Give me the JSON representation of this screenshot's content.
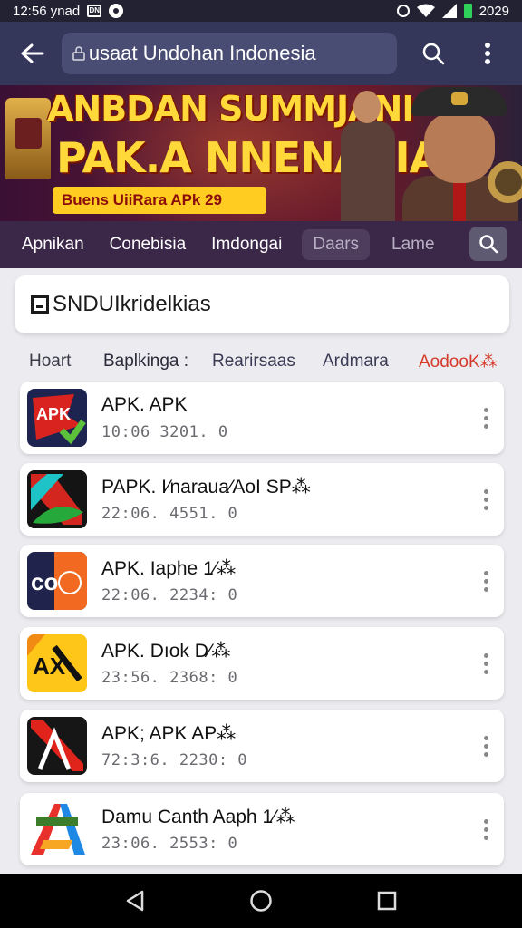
{
  "status_bar": {
    "time": "12:56 ynad",
    "box_icon_text": "DN",
    "battery_text": "2029"
  },
  "app_bar": {
    "search_value": "usaat Undohan Indonesia"
  },
  "banner": {
    "title_line1": "ANBDAN SUMMJANI",
    "title_line2": "PAK.A NNENASIAI",
    "tagline": "Buens UiiRara APk 29"
  },
  "categories": [
    {
      "label": "Apnikan"
    },
    {
      "label": "Conebisia"
    },
    {
      "label": "Imdongai"
    },
    {
      "label": "Daars"
    },
    {
      "label": "Lame"
    }
  ],
  "section": {
    "title": "SNDUIkridelkias"
  },
  "filters": [
    {
      "label": "Hoart"
    },
    {
      "label": "Baplkinga :"
    },
    {
      "label": "Rearirsaas"
    },
    {
      "label": "Ardmara"
    },
    {
      "label": "AodooK⁂"
    }
  ],
  "apps": [
    {
      "name": "APK. APK",
      "meta": "10:06  3201. 0",
      "icon": "apk-red-icon"
    },
    {
      "name": "PAPK. I⁄naraua⁄AoI SP⁂",
      "meta": "22:06. 4551. 0",
      "icon": "apk-green-icon"
    },
    {
      "name": "APK. Iaphe 1⁄⁂",
      "meta": "22:06. 2234: 0",
      "icon": "apk-orange-icon"
    },
    {
      "name": "APK. Dıok D⁄⁂",
      "meta": "23:56. 2368: 0",
      "icon": "apk-yellow-icon"
    },
    {
      "name": "APK; APK AP⁂",
      "meta": "72:3:6. 2230: 0",
      "icon": "apk-black-red-icon"
    },
    {
      "name": "Damu Canth Aaph 1⁄⁂",
      "meta": "23:06. 2553: 0",
      "icon": "apk-colorful-icon"
    }
  ],
  "colors": {
    "app_bar": "#34365a",
    "category_bar": "#3b2748",
    "accent_red": "#d53a2a",
    "banner_yellow": "#ffd93a"
  }
}
